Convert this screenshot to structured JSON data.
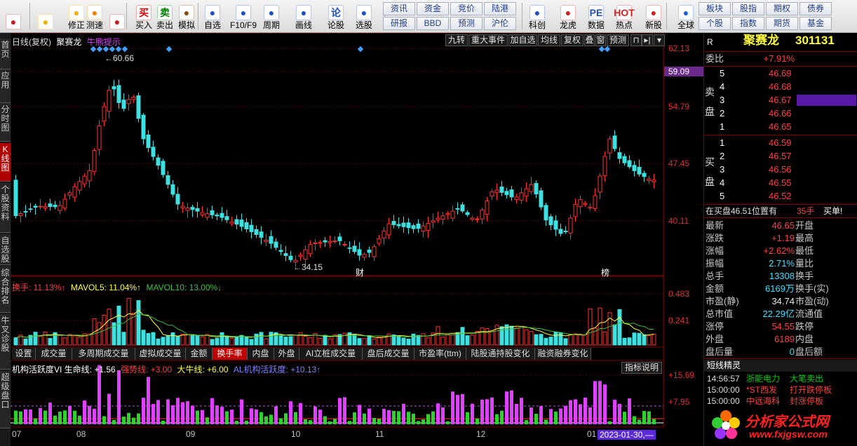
{
  "toolbar": {
    "buttons": [
      {
        "label": "",
        "icon": "grid-icon",
        "color": "#c02020"
      },
      {
        "label": "",
        "icon": "back-arrow-icon",
        "color": "#f0b000"
      },
      {
        "label": "修正",
        "icon": "up-down-icon",
        "color": "#f0b000"
      },
      {
        "label": "测速",
        "icon": "clock-icon",
        "color": "#f08000"
      },
      {
        "label": "",
        "icon": "clock-icon",
        "color": "#c02020"
      },
      {
        "label": "买入",
        "icon": "buy-icon",
        "glyph": "买",
        "color": "#d00000"
      },
      {
        "label": "卖出",
        "icon": "sell-icon",
        "glyph": "卖",
        "color": "#008000"
      },
      {
        "label": "模拟",
        "icon": "hammer-icon",
        "color": "#8a4a10"
      },
      {
        "label": "自选",
        "icon": "folder-icon",
        "color": "#2050c0"
      },
      {
        "label": "F10/F9",
        "icon": "document-icon",
        "color": "#2050c0"
      },
      {
        "label": "周期",
        "icon": "cycle-icon",
        "color": "#2050c0"
      },
      {
        "label": "画线",
        "icon": "pen-icon",
        "color": "#2050c0"
      },
      {
        "label": "论股",
        "icon": "discuss-icon",
        "glyph": "论",
        "color": "#2050c0"
      },
      {
        "label": "选股",
        "icon": "magnifier-chart-icon",
        "color": "#2050c0"
      },
      {
        "label": "科创",
        "icon": "chart-icon",
        "color": "#2050c0"
      },
      {
        "label": "龙虎",
        "icon": "dragon-icon",
        "color": "#d02020"
      },
      {
        "label": "数据",
        "icon": "pe-icon",
        "glyph": "PE",
        "color": "#2050c0"
      },
      {
        "label": "热点",
        "icon": "hot-icon",
        "glyph": "HOT",
        "color": "#d02020"
      },
      {
        "label": "新股",
        "icon": "calendar-icon",
        "color": "#d02020"
      },
      {
        "label": "全球",
        "icon": "globe-icon",
        "color": "#2060d0"
      }
    ],
    "small_buttons": [
      "资讯",
      "资金",
      "竞价",
      "陆港",
      "研报",
      "BBD",
      "预测",
      "沪伦",
      "板块",
      "股指",
      "期权",
      "债券",
      "个股",
      "指数",
      "期货",
      "基金"
    ]
  },
  "left_tabs": [
    {
      "label": "首页"
    },
    {
      "label": "应用"
    },
    {
      "label": "分时图"
    },
    {
      "label": "K线图",
      "active": true
    },
    {
      "label": "个股资料"
    },
    {
      "label": "自选股"
    },
    {
      "label": "综合排名"
    },
    {
      "label": "牛叉诊股"
    },
    {
      "label": "超级盘口"
    }
  ],
  "chart": {
    "title": "日线(复权)",
    "stock_name": "聚赛龙",
    "hint": "牛熊提示",
    "top_tabs": [
      "九转",
      "重大事件",
      "加自选",
      "均线",
      "复权",
      "叠",
      "窗",
      "预测"
    ],
    "price_ticks": [
      "62.13",
      "59.09",
      "54.79",
      "47.45",
      "40.11"
    ],
    "high_label": "60.66",
    "low_label": "34.15",
    "event_labels": [
      "财",
      "榜"
    ],
    "turnover": {
      "label": "换手: 11.13%↑",
      "mavol5": "MAVOL5: 11.04%↑",
      "mavol10": "MAVOL10: 13.00%↓",
      "ticks": [
        "0.483",
        "0.241"
      ]
    },
    "sub_tabs": [
      "设置",
      "成交量",
      "多周期成交量",
      "虚拟成交量",
      "金额",
      "换手率",
      "内盘",
      "外盘",
      "AI立桩成交量",
      "盘后成交量",
      "市盈率(ttm)",
      "陆股通持股变化",
      "融资融券变化"
    ],
    "active_sub_tab": "换手率",
    "indicator": {
      "label": "机构活跃度VI 生命线: +1.56",
      "strong": "强势线: +3.00",
      "bull": "大牛线: +6.00",
      "al": "AL机构活跃度: +10.13↑",
      "help": "指标说明",
      "ticks": [
        "+15.69",
        "+7.95"
      ]
    },
    "months": [
      "07",
      "08",
      "09",
      "10",
      "11",
      "12",
      "01"
    ],
    "date_tag": "2023-01-30,—"
  },
  "quote": {
    "code_label": "R",
    "name": "聚赛龙",
    "code": "301131",
    "webi": "委比",
    "webi_val": "+7.91%",
    "sell": [
      {
        "n": "5",
        "p": "46.69"
      },
      {
        "n": "4",
        "p": "46.68"
      },
      {
        "n": "3",
        "p": "46.67"
      },
      {
        "n": "2",
        "p": "46.66"
      },
      {
        "n": "1",
        "p": "46.65"
      }
    ],
    "buy": [
      {
        "n": "1",
        "p": "46.59"
      },
      {
        "n": "2",
        "p": "46.57"
      },
      {
        "n": "3",
        "p": "46.56"
      },
      {
        "n": "4",
        "p": "46.55"
      },
      {
        "n": "5",
        "p": "46.52"
      }
    ],
    "sell_side": "卖盘",
    "buy_side": "买盘",
    "order_text": "在买盘46.51位置有",
    "order_qty": "35手",
    "order_type": "买单!",
    "stats": [
      {
        "l1": "最新",
        "v1": "46.65",
        "c1": "red",
        "l2": "开盘",
        "v2": ""
      },
      {
        "l1": "涨跌",
        "v1": "+1.19",
        "c1": "red",
        "l2": "最高",
        "v2": ""
      },
      {
        "l1": "涨幅",
        "v1": "+2.62%",
        "c1": "red",
        "l2": "最低",
        "v2": ""
      },
      {
        "l1": "振幅",
        "v1": "2.71%",
        "c1": "cyan",
        "l2": "量比",
        "v2": ""
      },
      {
        "l1": "总手",
        "v1": "13308",
        "c1": "cyan",
        "l2": "换手",
        "v2": ""
      },
      {
        "l1": "金额",
        "v1": "6169万",
        "c1": "cyan",
        "l2": "换手(实)",
        "v2": ""
      },
      {
        "l1": "市盈(静)",
        "v1": "34.74",
        "c1": "white",
        "l2": "市盈(动)",
        "v2": ""
      },
      {
        "l1": "总市值",
        "v1": "22.29亿",
        "c1": "cyan",
        "l2": "流通值",
        "v2": ""
      },
      {
        "l1": "涨停",
        "v1": "54.55",
        "c1": "red",
        "l2": "跌停",
        "v2": ""
      },
      {
        "l1": "外盘",
        "v1": "6189",
        "c1": "red",
        "l2": "内盘",
        "v2": ""
      },
      {
        "l1": "盘后量",
        "v1": "0",
        "c1": "cyan",
        "l2": "盘后额",
        "v2": ""
      }
    ],
    "news_title": "短线精灵",
    "news": [
      {
        "time": "14:56:57",
        "name": "浙能电力",
        "event": "大笔卖出",
        "color": "green"
      },
      {
        "time": "15:00:00",
        "name": "*ST西发",
        "event": "打开跌停板",
        "color": "red"
      },
      {
        "time": "15:00:00",
        "name": "中远海科",
        "event": "封涨停板",
        "color": "red"
      }
    ],
    "logo_text": "分析家公式网",
    "logo_url": "www.fxjgsw.com"
  }
}
